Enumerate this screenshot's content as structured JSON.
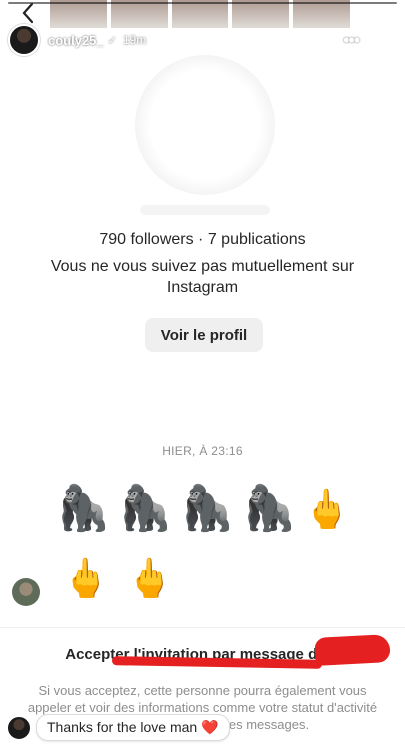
{
  "story": {
    "username": "couly25_",
    "verified_mark": "✓",
    "time": "19m",
    "progress": 1.0
  },
  "profile": {
    "stats": "790 followers · 7 publications",
    "mutual": "Vous ne vous suivez pas mutuellement sur Instagram",
    "view_button": "Voir le profil"
  },
  "messages": {
    "timestamp": "HIER, À 23:16",
    "row1": [
      "🦍",
      "🦍",
      "🦍",
      "🦍",
      "🖕"
    ],
    "row2": [
      "🖕",
      "🖕"
    ]
  },
  "request": {
    "title": "Accepter l'invitation par message de S",
    "description": "Si vous acceptez, cette personne pourra également vous appeler et voir des informations comme votre statut d'activité et quand vous avez lu les messages."
  },
  "reply": {
    "text": "Thanks for the love man ❤️"
  },
  "colors": {
    "redaction": "#e52020",
    "muted_text": "#8e8e8e",
    "button_bg": "#efefef"
  }
}
